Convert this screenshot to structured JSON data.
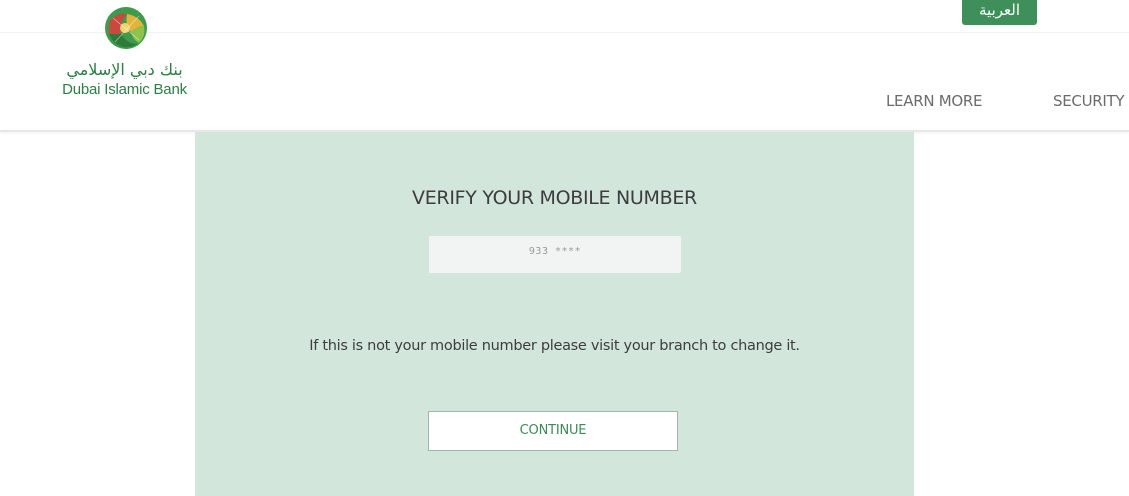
{
  "header": {
    "logo": {
      "name_ar": "بنك دبي الإسلامي",
      "name_en": "Dubai Islamic Bank",
      "icon": "globe-logo-icon"
    },
    "language_label": "العربية",
    "nav": [
      {
        "label": "LEARN MORE"
      },
      {
        "label": "SECURITY"
      }
    ]
  },
  "verify": {
    "title": "VERIFY YOUR MOBILE NUMBER",
    "masked_number": "933 ****",
    "info": "If this is not your mobile number please visit your branch to change it.",
    "continue_label": "CONTINUE"
  },
  "colors": {
    "brand_green": "#3f8f5a",
    "panel_bg": "#d3e6dc",
    "text_dark": "#3d3d3d",
    "nav_text": "#6b6b6b"
  }
}
